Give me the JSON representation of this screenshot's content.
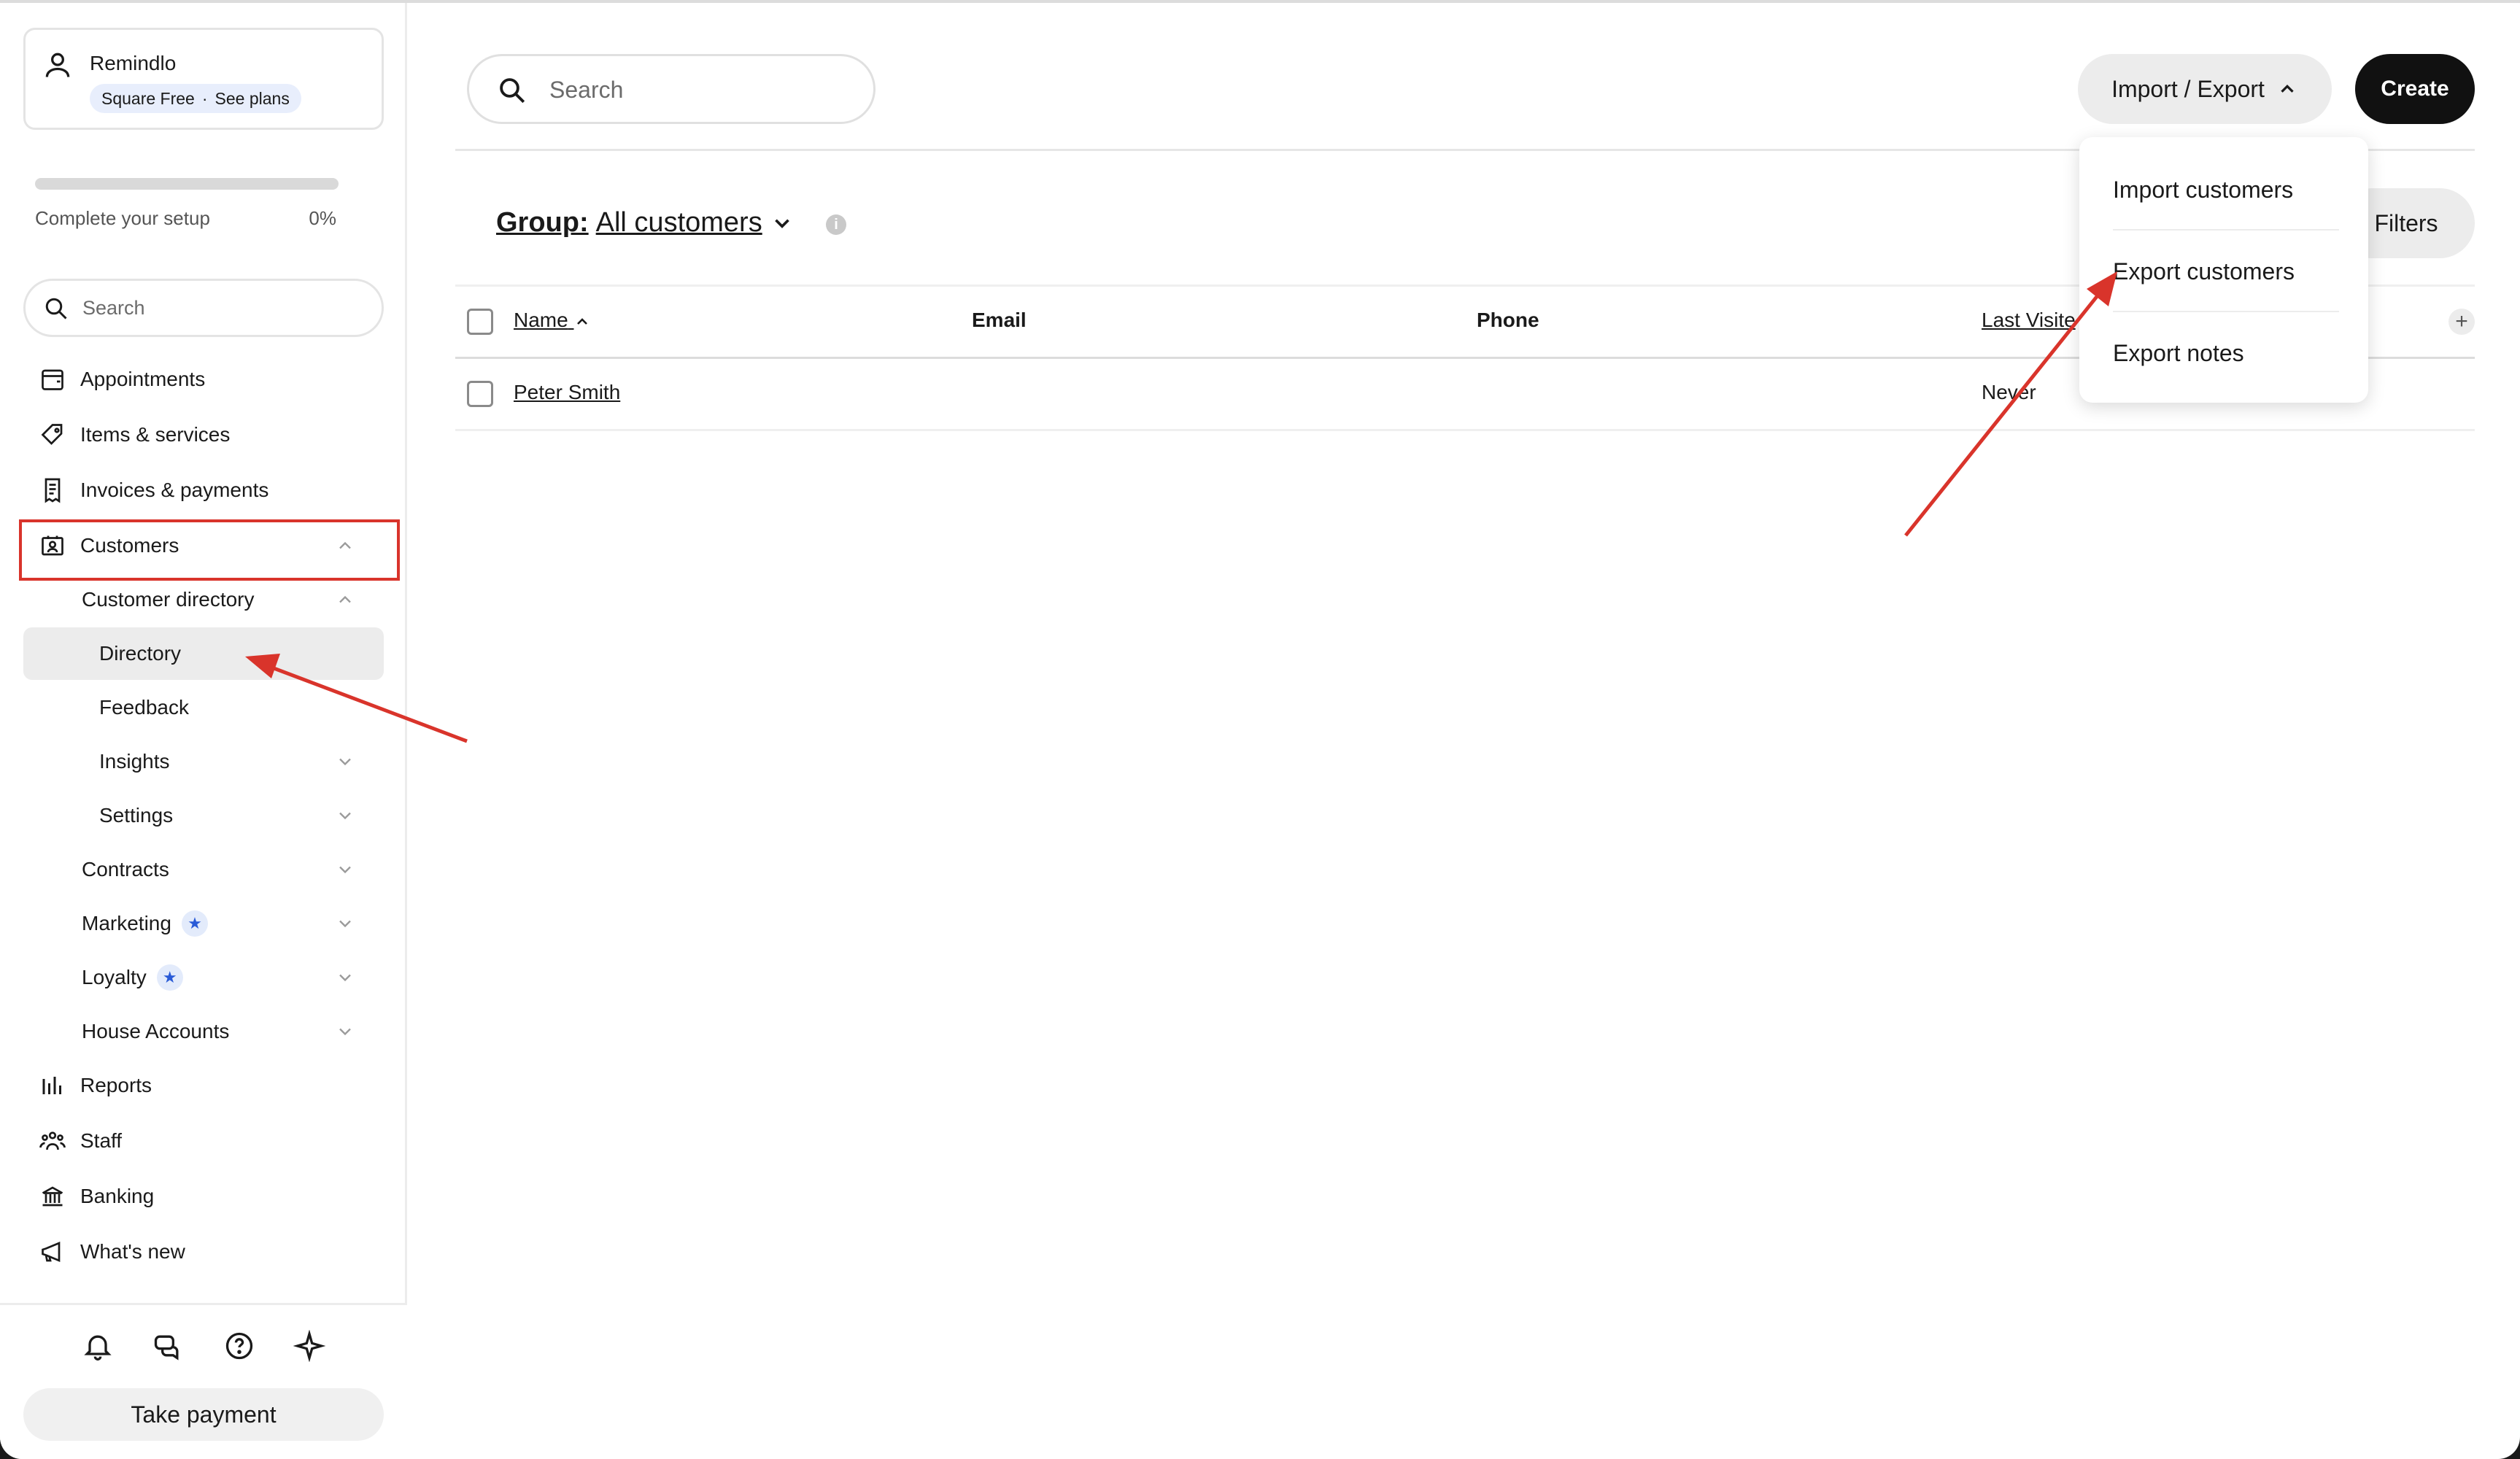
{
  "sidebar": {
    "account": {
      "name": "Remindlo",
      "plan": "Square Free",
      "separator": "·",
      "see_plans": "See plans"
    },
    "setup": {
      "label": "Complete your setup",
      "percent": "0%",
      "progress": 0
    },
    "search": {
      "placeholder": "Search"
    },
    "nav": {
      "appointments": "Appointments",
      "items_services": "Items & services",
      "invoices_payments": "Invoices & payments",
      "customers": "Customers",
      "customer_directory": "Customer directory",
      "directory": "Directory",
      "feedback": "Feedback",
      "insights": "Insights",
      "settings": "Settings",
      "contracts": "Contracts",
      "marketing": "Marketing",
      "loyalty": "Loyalty",
      "house_accounts": "House Accounts",
      "reports": "Reports",
      "staff": "Staff",
      "banking": "Banking",
      "whats_new": "What's new"
    },
    "star": "★",
    "take_payment": "Take payment"
  },
  "main": {
    "search": {
      "placeholder": "Search"
    },
    "import_export": "Import / Export",
    "create": "Create",
    "group": {
      "label": "Group:",
      "value": "All customers"
    },
    "info": "i",
    "filters": "Filters",
    "table": {
      "headers": {
        "name": "Name",
        "email": "Email",
        "phone": "Phone",
        "last_visited": "Last Visite"
      },
      "plus": "+",
      "rows": [
        {
          "name": "Peter Smith",
          "email": "",
          "phone": "",
          "last_visited": "Never"
        }
      ]
    },
    "dropdown": {
      "import_customers": "Import customers",
      "export_customers": "Export customers",
      "export_notes": "Export notes"
    }
  },
  "colors": {
    "annotation_red": "#d9342b",
    "badge_blue": "#2a5bd7",
    "primary_black": "#111111"
  }
}
